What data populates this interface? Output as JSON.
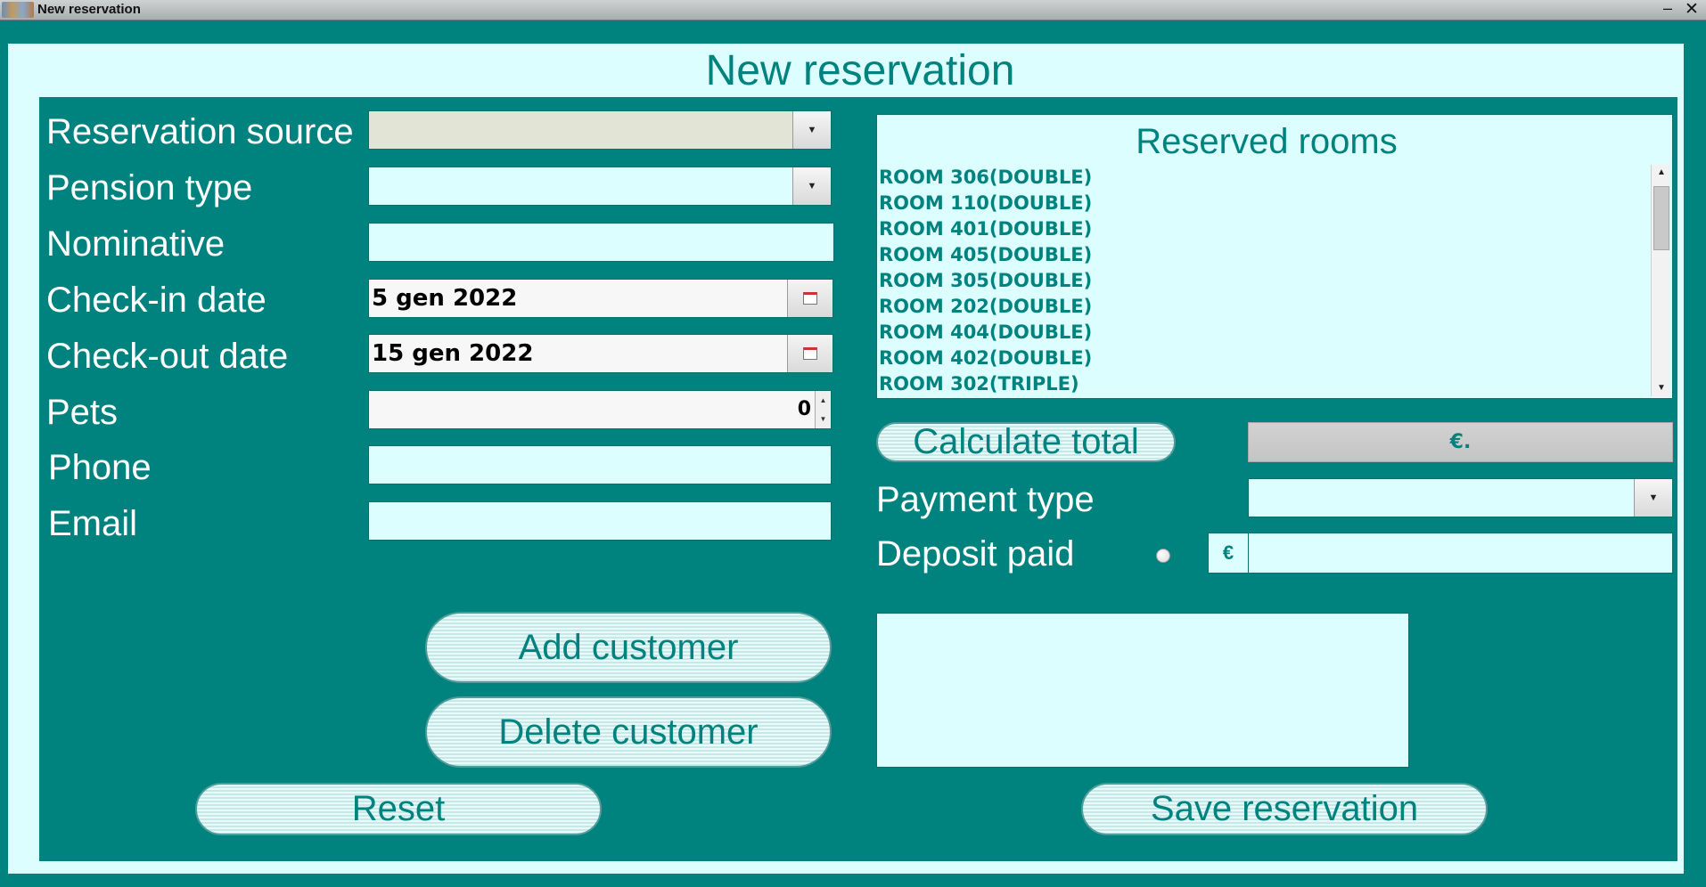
{
  "window": {
    "title": "New reservation",
    "minimize_glyph": "–",
    "close_glyph": "✕"
  },
  "heading": "New reservation",
  "form": {
    "reservation_source": {
      "label": "Reservation source",
      "value": ""
    },
    "pension_type": {
      "label": "Pension type",
      "value": ""
    },
    "nominative": {
      "label": "Nominative",
      "value": ""
    },
    "checkin": {
      "label": "Check-in date",
      "value": "5 gen 2022"
    },
    "checkout": {
      "label": "Check-out date",
      "value": "15 gen 2022"
    },
    "pets": {
      "label": "Pets",
      "value": "0"
    },
    "phone": {
      "label": "Phone",
      "value": ""
    },
    "email": {
      "label": "Email",
      "value": ""
    }
  },
  "buttons": {
    "add_customer": "Add customer",
    "delete_customer": "Delete customer",
    "reset": "Reset",
    "save_reservation": "Save reservation",
    "calculate_total": "Calculate total"
  },
  "reserved_rooms": {
    "title": "Reserved rooms",
    "items": [
      "ROOM 306(DOUBLE)",
      "ROOM 110(DOUBLE)",
      "ROOM 401(DOUBLE)",
      "ROOM 405(DOUBLE)",
      "ROOM 305(DOUBLE)",
      "ROOM 202(DOUBLE)",
      "ROOM 404(DOUBLE)",
      "ROOM 402(DOUBLE)",
      "ROOM 302(TRIPLE)"
    ]
  },
  "total": {
    "value": "€."
  },
  "payment": {
    "label": "Payment type",
    "value": ""
  },
  "deposit": {
    "label": "Deposit paid",
    "currency": "€",
    "value": ""
  },
  "colors": {
    "teal": "#00827f",
    "light_cyan": "#ddfefe"
  }
}
